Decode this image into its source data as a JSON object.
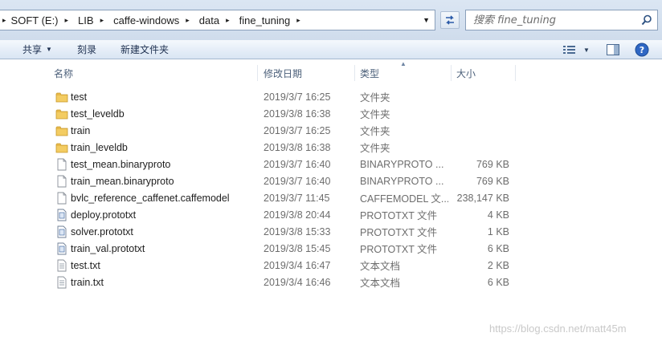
{
  "breadcrumb": {
    "items": [
      "SOFT (E:)",
      "LIB",
      "caffe-windows",
      "data",
      "fine_tuning"
    ]
  },
  "search": {
    "placeholder": "搜索 fine_tuning"
  },
  "toolbar": {
    "share_label": "共享",
    "burn_label": "刻录",
    "new_folder_label": "新建文件夹"
  },
  "columns": {
    "name": "名称",
    "date": "修改日期",
    "type": "类型",
    "size": "大小"
  },
  "files": [
    {
      "name": "test",
      "date": "2019/3/7 16:25",
      "type": "文件夹",
      "size": "",
      "icon": "folder-icon"
    },
    {
      "name": "test_leveldb",
      "date": "2019/3/8 16:38",
      "type": "文件夹",
      "size": "",
      "icon": "folder-icon"
    },
    {
      "name": "train",
      "date": "2019/3/7 16:25",
      "type": "文件夹",
      "size": "",
      "icon": "folder-icon"
    },
    {
      "name": "train_leveldb",
      "date": "2019/3/8 16:38",
      "type": "文件夹",
      "size": "",
      "icon": "folder-icon"
    },
    {
      "name": "test_mean.binaryproto",
      "date": "2019/3/7 16:40",
      "type": "BINARYPROTO ...",
      "size": "769 KB",
      "icon": "file-icon"
    },
    {
      "name": "train_mean.binaryproto",
      "date": "2019/3/7 16:40",
      "type": "BINARYPROTO ...",
      "size": "769 KB",
      "icon": "file-icon"
    },
    {
      "name": "bvlc_reference_caffenet.caffemodel",
      "date": "2019/3/7 11:45",
      "type": "CAFFEMODEL 文...",
      "size": "238,147 KB",
      "icon": "file-icon"
    },
    {
      "name": "deploy.prototxt",
      "date": "2019/3/8 20:44",
      "type": "PROTOTXT 文件",
      "size": "4 KB",
      "icon": "prototxt-file-icon"
    },
    {
      "name": "solver.prototxt",
      "date": "2019/3/8 15:33",
      "type": "PROTOTXT 文件",
      "size": "1 KB",
      "icon": "prototxt-file-icon"
    },
    {
      "name": "train_val.prototxt",
      "date": "2019/3/8 15:45",
      "type": "PROTOTXT 文件",
      "size": "6 KB",
      "icon": "prototxt-file-icon"
    },
    {
      "name": "test.txt",
      "date": "2019/3/4 16:47",
      "type": "文本文档",
      "size": "2 KB",
      "icon": "text-file-icon"
    },
    {
      "name": "train.txt",
      "date": "2019/3/4 16:46",
      "type": "文本文档",
      "size": "6 KB",
      "icon": "text-file-icon"
    }
  ],
  "watermark": "https://blog.csdn.net/matt45m",
  "colors": {
    "toolbar_text": "#1e3050",
    "header_text": "#4c607a",
    "secondary_text": "#6d6d6d",
    "folder": "#e8b94a"
  }
}
